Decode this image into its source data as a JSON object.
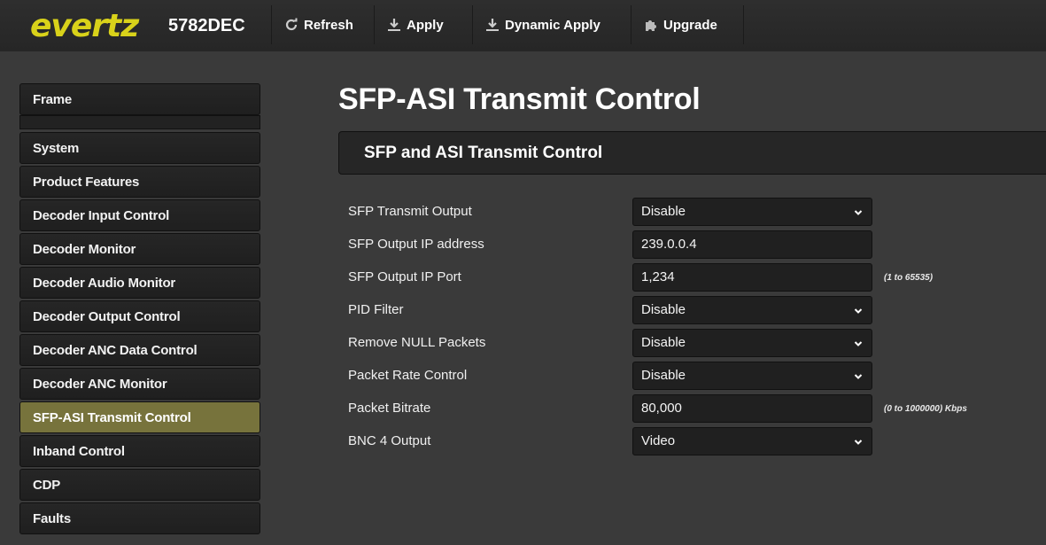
{
  "header": {
    "brand": "evertz",
    "model": "5782DEC",
    "buttons": [
      {
        "label": "Refresh",
        "icon": "refresh-icon"
      },
      {
        "label": "Apply",
        "icon": "download-arrow-icon"
      },
      {
        "label": "Dynamic Apply",
        "icon": "download-arrow-icon"
      },
      {
        "label": "Upgrade",
        "icon": "puzzle-icon"
      }
    ]
  },
  "sidebar": {
    "items": [
      {
        "label": "Frame"
      },
      {
        "label": "System"
      },
      {
        "label": "Product Features"
      },
      {
        "label": "Decoder Input Control"
      },
      {
        "label": "Decoder Monitor"
      },
      {
        "label": "Decoder Audio Monitor"
      },
      {
        "label": "Decoder Output Control"
      },
      {
        "label": "Decoder ANC Data Control"
      },
      {
        "label": "Decoder ANC Monitor"
      },
      {
        "label": "SFP-ASI Transmit Control",
        "active": true
      },
      {
        "label": "Inband Control"
      },
      {
        "label": "CDP"
      },
      {
        "label": "Faults"
      }
    ],
    "active_color": "#77733c"
  },
  "main": {
    "title": "SFP-ASI Transmit Control",
    "section_title": "SFP and ASI Transmit Control",
    "fields": [
      {
        "label": "SFP Transmit Output",
        "value": "Disable",
        "type": "select"
      },
      {
        "label": "SFP Output IP address",
        "value": "239.0.0.4",
        "type": "input"
      },
      {
        "label": "SFP Output IP Port",
        "value": "1,234",
        "type": "input",
        "hint": "(1 to 65535)"
      },
      {
        "label": "PID Filter",
        "value": "Disable",
        "type": "select"
      },
      {
        "label": "Remove NULL Packets",
        "value": "Disable",
        "type": "select"
      },
      {
        "label": "Packet Rate Control",
        "value": "Disable",
        "type": "select"
      },
      {
        "label": "Packet Bitrate",
        "value": "80,000",
        "type": "input",
        "hint": "(0 to 1000000) Kbps"
      },
      {
        "label": "BNC 4 Output",
        "value": "Video",
        "type": "select"
      }
    ]
  },
  "colors": {
    "brand_yellow": "#d9d21a",
    "background": "#3a3a3a",
    "panel": "#262626"
  }
}
